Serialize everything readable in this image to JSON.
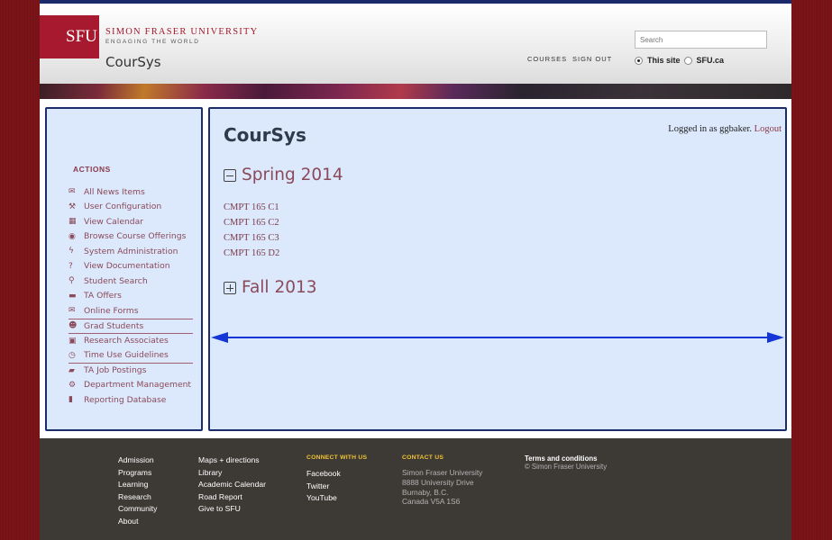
{
  "header": {
    "logo_text": "SFU",
    "university_name": "SIMON FRASER UNIVERSITY",
    "tagline": "ENGAGING THE WORLD",
    "app_title": "CourSys",
    "nav": [
      "COURSES",
      "SIGN OUT"
    ],
    "search_placeholder": "Search",
    "scope_options": [
      {
        "label": "This site",
        "selected": true
      },
      {
        "label": "SFU.ca",
        "selected": false
      }
    ]
  },
  "sidebar": {
    "heading": "ACTIONS",
    "items": [
      {
        "label": "All News Items",
        "icon": "envelope-icon"
      },
      {
        "label": "User Configuration",
        "icon": "wrench-icon"
      },
      {
        "label": "View Calendar",
        "icon": "calendar-icon"
      },
      {
        "label": "Browse Course Offerings",
        "icon": "eye-icon"
      },
      {
        "label": "System Administration",
        "icon": "bolt-icon"
      },
      {
        "label": "View Documentation",
        "icon": "question-icon"
      },
      {
        "label": "Student Search",
        "icon": "search-icon"
      },
      {
        "label": "TA Offers",
        "icon": "folder-icon"
      },
      {
        "label": "Online Forms",
        "icon": "envelope-outline-icon"
      },
      {
        "label": "Grad Students",
        "icon": "users-icon"
      },
      {
        "label": "Research Associates",
        "icon": "money-icon"
      },
      {
        "label": "Time Use Guidelines",
        "icon": "clock-icon"
      },
      {
        "label": "TA Job Postings",
        "icon": "briefcase-icon"
      },
      {
        "label": "Department Management",
        "icon": "cogs-icon"
      },
      {
        "label": "Reporting Database",
        "icon": "book-icon"
      }
    ]
  },
  "main": {
    "title": "CourSys",
    "login_text": "Logged in as ggbaker.",
    "logout_label": "Logout",
    "semesters": [
      {
        "name": "Spring 2014",
        "expanded": true,
        "courses": [
          "CMPT 165 C1",
          "CMPT 165 C2",
          "CMPT 165 C3",
          "CMPT 165 D2"
        ]
      },
      {
        "name": "Fall 2013",
        "expanded": false,
        "courses": []
      }
    ]
  },
  "footer": {
    "col1": [
      "Admission",
      "Programs",
      "Learning",
      "Research",
      "Community",
      "About"
    ],
    "col2": [
      "Maps + directions",
      "Library",
      "Academic Calendar",
      "Road Report",
      "Give to SFU"
    ],
    "connect_heading": "CONNECT WITH US",
    "connect": [
      "Facebook",
      "Twitter",
      "YouTube"
    ],
    "contact_heading": "CONTACT US",
    "contact": [
      "Simon Fraser University",
      "8888 University Drive",
      "Burnaby, B.C.",
      "Canada V5A 1S6"
    ],
    "terms": "Terms and conditions",
    "copyright": "© Simon Fraser University"
  },
  "colors": {
    "background": "#7a1418",
    "sfu_red": "#a6192e",
    "panel_fill": "#dce8fb",
    "panel_border": "#1a2c6b",
    "arrow": "#1536d6",
    "footer_bg": "#3d3a36",
    "footer_heading": "#f1c232"
  }
}
